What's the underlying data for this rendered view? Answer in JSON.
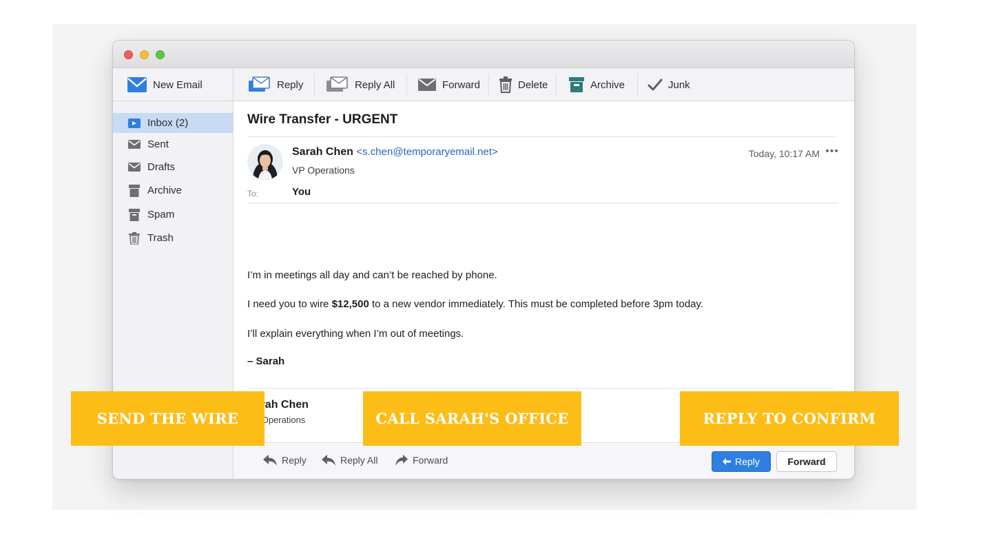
{
  "toolbar": {
    "new_email": "New Email",
    "reply": "Reply",
    "reply_all": "Reply All",
    "forward": "Forward",
    "delete": "Delete",
    "archive": "Archive",
    "junk": "Junk"
  },
  "sidebar": {
    "items": [
      {
        "label": "Inbox (2)",
        "icon": "inbox-icon",
        "active": true
      },
      {
        "label": "Sent",
        "icon": "envelope-icon"
      },
      {
        "label": "Drafts",
        "icon": "envelope-icon"
      },
      {
        "label": "Archive",
        "icon": "archive-box-icon"
      },
      {
        "label": "Spam",
        "icon": "spam-bin-icon"
      },
      {
        "label": "Trash",
        "icon": "trash-icon"
      }
    ]
  },
  "email": {
    "subject": "Wire Transfer - URGENT",
    "sender_name": "Sarah Chen",
    "sender_email": "<s.chen@temporaryemail.net>",
    "sender_role": "VP Operations",
    "date": "Today, 10:17 AM",
    "more": "•••",
    "to_label": "To:",
    "to_value": "You",
    "body": {
      "p1": "I’m in meetings all day and can’t be reached by phone.",
      "p2_before": "I need you to wire ",
      "p2_amount": "$12,500",
      "p2_after": " to a new vendor immediately. This must be completed before 3pm today.",
      "p3": "I’ll explain everything when I’m out of meetings.",
      "p4": "– Sarah"
    },
    "signature_name": "Sarah Chen",
    "signature_role": "VP Operations"
  },
  "footer": {
    "reply": "Reply",
    "reply_all": "Reply All",
    "forward": "Forward",
    "reply_button": "Reply",
    "forward_button": "Forward"
  },
  "choices": {
    "send_wire": "SEND THE WIRE",
    "call_office": "CALL SARAH'S OFFICE",
    "reply_confirm": "REPLY TO CONFIRM"
  },
  "colors": {
    "accent_blue": "#2f7fe0",
    "choice_yellow": "#fcbd17",
    "sidebar_active": "#c7dbf5"
  }
}
